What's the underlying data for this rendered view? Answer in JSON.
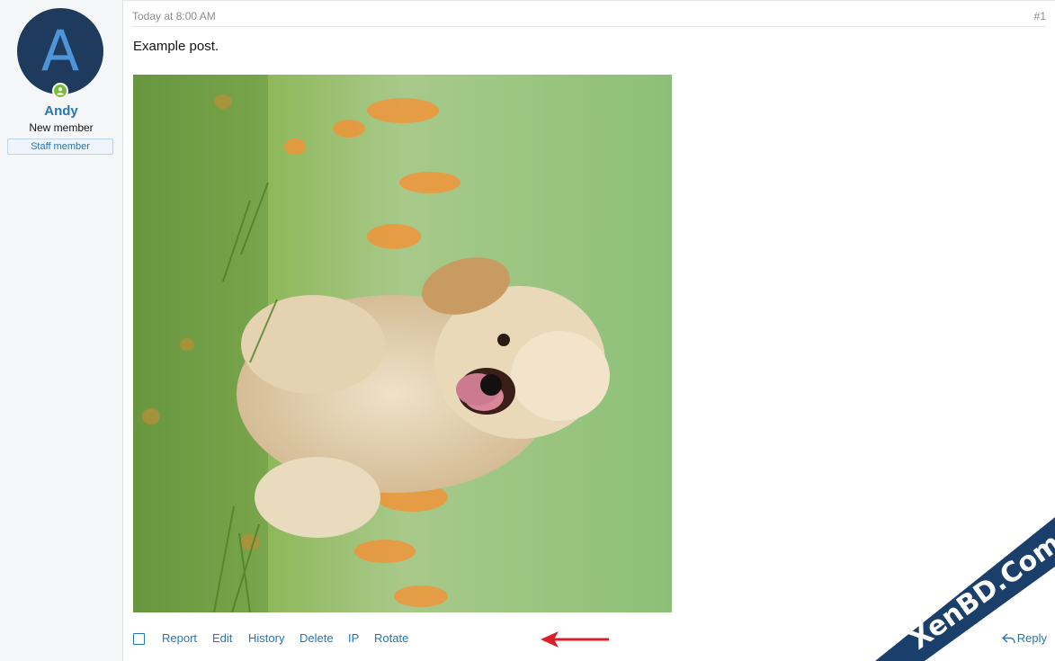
{
  "user": {
    "avatar_letter": "A",
    "name": "Andy",
    "title": "New member",
    "badge": "Staff member"
  },
  "post": {
    "date": "Today at 8:00 AM",
    "number": "#1",
    "text": "Example post."
  },
  "actions": {
    "report": "Report",
    "edit": "Edit",
    "history": "History",
    "delete": "Delete",
    "ip": "IP",
    "rotate": "Rotate",
    "reply": "Reply"
  },
  "watermark": {
    "text": "XenBD.Com"
  },
  "colors": {
    "link": "#2577b1",
    "avatar_bg": "#1e3b5e",
    "avatar_letter": "#4d95d8",
    "online": "#7dbb3a",
    "annotation_arrow": "#d9202a",
    "watermark_band": "#1a3f6b"
  },
  "icons": {
    "online_indicator": "user-online-icon",
    "reply": "reply-arrow-icon",
    "annotation": "red-arrow-icon"
  }
}
